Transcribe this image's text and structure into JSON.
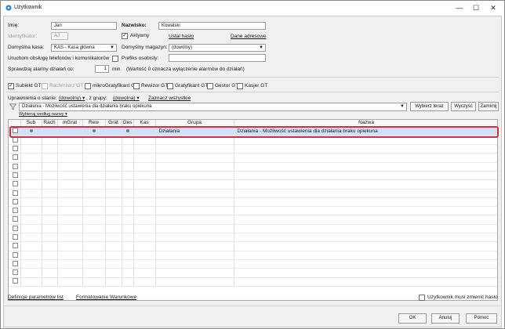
{
  "window": {
    "title": "Użytkownik",
    "minimize": "—",
    "maximize": "☐",
    "close": "✕"
  },
  "form": {
    "imie_label": "Imię:",
    "imie_value": "Jan",
    "nazwisko_label": "Nazwisko:",
    "nazwisko_value": "Kowalski",
    "identyfikator_label": "Identyfikator:",
    "identyfikator_value": "AJ",
    "aktywny_label": "Aktywny",
    "aktywny_checked": true,
    "ustal_haslo": "Ustal hasło",
    "dane_adresowe": "Dane adresowe",
    "kasa_label": "Domyślna kasa:",
    "kasa_value": "KAS - Kasa główna",
    "magazyn_label": "Domyślny magazyn:",
    "magazyn_value": "(dowolny)",
    "uruchom_label": "Uruchom obsługę telefonów i komunikatorów",
    "prefiks_label": "Prefiks osobisty:",
    "prefiks_value": "",
    "alarmy_label": "Sprawdzaj alarmy działań co:",
    "alarmy_value": "1",
    "alarmy_unit": "min",
    "alarmy_note": "(Wartość 0 oznacza wyłączenie alarmów do działań)"
  },
  "modules": [
    {
      "label": "Subiekt GT",
      "checked": true,
      "disabled": false
    },
    {
      "label": "Rachmistrz GT",
      "checked": false,
      "disabled": true
    },
    {
      "label": "mikroGratyfikant GT",
      "checked": false,
      "disabled": false
    },
    {
      "label": "Rewizor GT",
      "checked": false,
      "disabled": false
    },
    {
      "label": "Gratyfikant GT",
      "checked": false,
      "disabled": false
    },
    {
      "label": "Gestor GT",
      "checked": false,
      "disabled": false
    },
    {
      "label": "Kasjer GT",
      "checked": false,
      "disabled": false
    }
  ],
  "filters": {
    "uprawnienia_label": "Uprawnienia o stanie:",
    "stan_value": "(dowolny)",
    "grupy_label": ", z grupy:",
    "grupa_value": "(dowolna)",
    "zaznacz_wszystkie": "Zaznacz wszystkie",
    "search_value": "Działania - Możliwość ustawienia dla działania braku opiekuna",
    "wybierz_teraz": "Wybierz teraz",
    "wyczysc": "Wyczyść",
    "zamknij": "Zamknij",
    "wybieraj_wedlug": "Wybieraj według nazwy"
  },
  "grid": {
    "columns": [
      "",
      "Sub",
      "Rach",
      "mGrat",
      "Rew",
      "Grat",
      "Ges",
      "Kas",
      "Grupa",
      "Nazwa"
    ],
    "selected_row": {
      "sub": true,
      "rach": false,
      "mgrat": false,
      "rew": true,
      "grat": false,
      "ges": true,
      "kas": false,
      "grupa": "Działania",
      "nazwa": "Działania - Możliwość ustawienia dla działania braku opiekuna"
    }
  },
  "footer": {
    "definicje": "Definicje parametrów list",
    "formatowanie": "Formatowanie Warunkowe",
    "musi_zmienic": "Użytkownik musi zmienić hasło",
    "ok": "OK",
    "anuluj": "Anuluj",
    "pomoc": "Pomoc"
  },
  "colors": {
    "selection": "#cde3f6",
    "highlight_ring": "#d2303a"
  }
}
